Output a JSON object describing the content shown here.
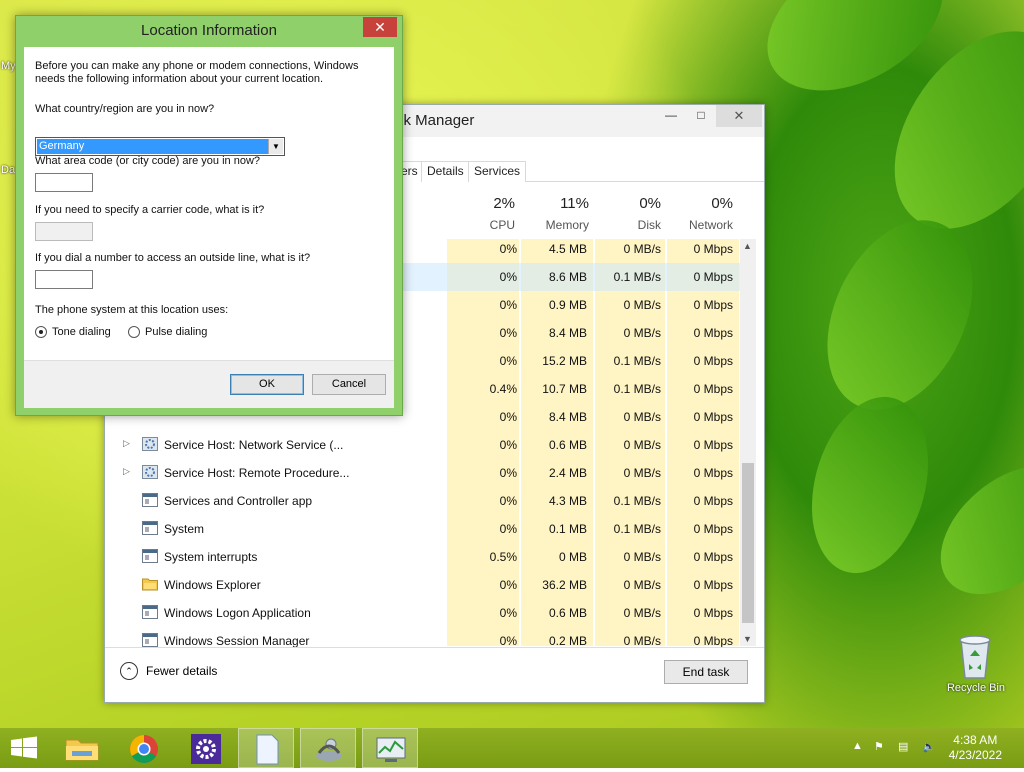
{
  "desktop": {
    "recycle_bin_label": "Recycle Bin",
    "icon_label_top": "My",
    "icon_label_mid": "Da"
  },
  "task_manager": {
    "title": "sk Manager",
    "tabs": [
      "ers",
      "Details",
      "Services"
    ],
    "columns": [
      {
        "pct": "2%",
        "name": "CPU"
      },
      {
        "pct": "11%",
        "name": "Memory"
      },
      {
        "pct": "0%",
        "name": "Disk"
      },
      {
        "pct": "0%",
        "name": "Network"
      }
    ],
    "rows": [
      {
        "name": "",
        "cpu": "0%",
        "mem": "4.5 MB",
        "disk": "0 MB/s",
        "net": "0 Mbps",
        "icon": "none",
        "expand": false
      },
      {
        "name": "",
        "cpu": "0%",
        "mem": "8.6 MB",
        "disk": "0.1 MB/s",
        "net": "0 Mbps",
        "icon": "none",
        "expand": false
      },
      {
        "name": "",
        "cpu": "0%",
        "mem": "0.9 MB",
        "disk": "0 MB/s",
        "net": "0 Mbps",
        "icon": "none",
        "expand": false
      },
      {
        "name": "",
        "cpu": "0%",
        "mem": "8.4 MB",
        "disk": "0 MB/s",
        "net": "0 Mbps",
        "icon": "none",
        "expand": false
      },
      {
        "name": "",
        "cpu": "0%",
        "mem": "15.2 MB",
        "disk": "0.1 MB/s",
        "net": "0 Mbps",
        "icon": "none",
        "expand": false
      },
      {
        "name": "",
        "cpu": "0.4%",
        "mem": "10.7 MB",
        "disk": "0.1 MB/s",
        "net": "0 Mbps",
        "icon": "none",
        "expand": false
      },
      {
        "name": "",
        "cpu": "0%",
        "mem": "8.4 MB",
        "disk": "0 MB/s",
        "net": "0 Mbps",
        "icon": "none",
        "expand": false
      },
      {
        "name": "Service Host: Network Service (...",
        "cpu": "0%",
        "mem": "0.6 MB",
        "disk": "0 MB/s",
        "net": "0 Mbps",
        "icon": "gear",
        "expand": true
      },
      {
        "name": "Service Host: Remote Procedure...",
        "cpu": "0%",
        "mem": "2.4 MB",
        "disk": "0 MB/s",
        "net": "0 Mbps",
        "icon": "gear",
        "expand": true
      },
      {
        "name": "Services and Controller app",
        "cpu": "0%",
        "mem": "4.3 MB",
        "disk": "0.1 MB/s",
        "net": "0 Mbps",
        "icon": "window",
        "expand": false
      },
      {
        "name": "System",
        "cpu": "0%",
        "mem": "0.1 MB",
        "disk": "0.1 MB/s",
        "net": "0 Mbps",
        "icon": "window",
        "expand": false
      },
      {
        "name": "System interrupts",
        "cpu": "0.5%",
        "mem": "0 MB",
        "disk": "0 MB/s",
        "net": "0 Mbps",
        "icon": "window",
        "expand": false
      },
      {
        "name": "Windows Explorer",
        "cpu": "0%",
        "mem": "36.2 MB",
        "disk": "0 MB/s",
        "net": "0 Mbps",
        "icon": "folder",
        "expand": false
      },
      {
        "name": "Windows Logon Application",
        "cpu": "0%",
        "mem": "0.6 MB",
        "disk": "0 MB/s",
        "net": "0 Mbps",
        "icon": "window",
        "expand": false
      },
      {
        "name": "Windows Session Manager",
        "cpu": "0%",
        "mem": "0.2 MB",
        "disk": "0 MB/s",
        "net": "0 Mbps",
        "icon": "window",
        "expand": false
      }
    ],
    "fewer_details": "Fewer details",
    "end_task": "End task"
  },
  "dialog": {
    "title": "Location Information",
    "intro": "Before you can make any phone or modem connections, Windows needs the following information about your current location.",
    "q_country": "What country/region are you in now?",
    "country_value": "Germany",
    "q_area": "What area code (or city code) are you in now?",
    "area_value": "",
    "q_carrier": "If you need to specify a carrier code, what is it?",
    "carrier_value": "",
    "q_outside": "If you dial a number to access an outside line, what is it?",
    "outside_value": "",
    "q_phone_system": "The phone system at this location uses:",
    "tone": "Tone dialing",
    "pulse": "Pulse dialing",
    "ok": "OK",
    "cancel": "Cancel"
  },
  "taskbar": {
    "time": "4:38 AM",
    "date": "4/23/2022"
  }
}
